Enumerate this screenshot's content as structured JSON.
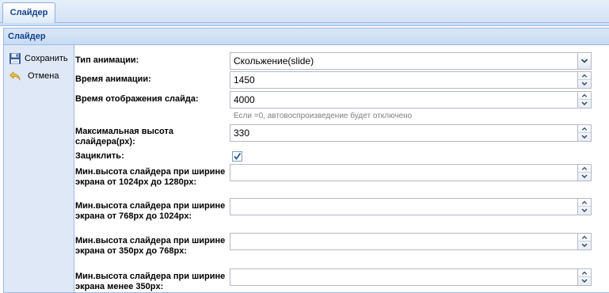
{
  "tabs": [
    {
      "label": "Слайдер"
    }
  ],
  "panel": {
    "title": "Слайдер"
  },
  "toolbar": {
    "save_label": "Сохранить",
    "cancel_label": "Отмена"
  },
  "form": {
    "animation_type": {
      "label": "Тип анимации:",
      "value": "Скольжение(slide)"
    },
    "animation_time": {
      "label": "Время анимации:",
      "value": "1450"
    },
    "display_time": {
      "label": "Время отображения слайда:",
      "value": "4000",
      "hint": "Если =0, автовоспроизведение будет отключено"
    },
    "max_height": {
      "label": "Максимальная высота слайдера(px):",
      "value": "330"
    },
    "loop": {
      "label": "Зациклить:",
      "checked": true
    },
    "min_h_1024": {
      "label": "Мин.высота слайдера при ширине экрана от 1024px до 1280px:",
      "value": ""
    },
    "min_h_768": {
      "label": "Мин.высота слайдера при ширине экрана от 768px до 1024px:",
      "value": ""
    },
    "min_h_350": {
      "label": "Мин.высота слайдера при ширине экрана от 350px до 768px:",
      "value": ""
    },
    "min_h_lt350": {
      "label": "Мин.высота слайдера при ширине экрана менее 350px:",
      "value": ""
    }
  },
  "icons": {
    "save": "floppy-disk-icon",
    "cancel": "undo-arrow-icon",
    "combo": "chevron-down-icon",
    "spinner": "spinner-arrows-icon"
  },
  "colors": {
    "header_text": "#15428b",
    "border": "#99bbe8",
    "toolbar_bg": "#dfe8f6"
  }
}
